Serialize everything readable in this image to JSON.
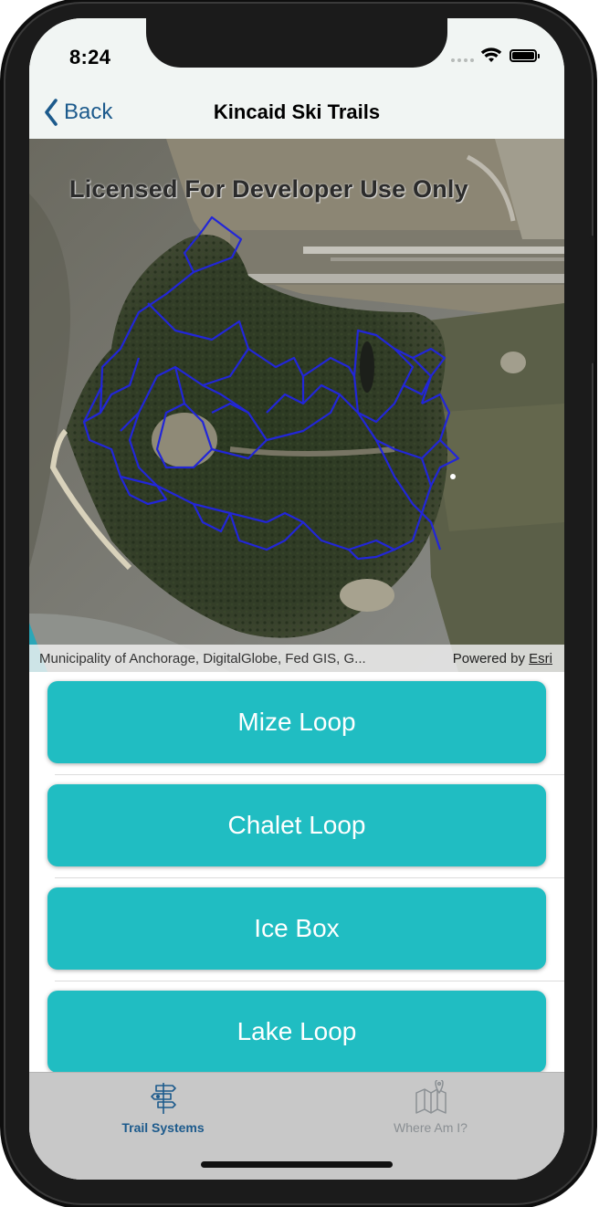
{
  "status_bar": {
    "time": "8:24",
    "signal_icon": "cellular-dots-icon",
    "wifi_icon": "wifi-icon",
    "battery_icon": "battery-icon"
  },
  "nav": {
    "back_label": "Back",
    "back_icon": "chevron-left-icon",
    "title": "Kincaid Ski Trails"
  },
  "map": {
    "watermark": "Licensed For Developer Use Only",
    "attribution": "Municipality of Anchorage, DigitalGlobe, Fed GIS, G...",
    "powered_by_prefix": "Powered by",
    "powered_by_link": "Esri",
    "trail_color": "#2226d8"
  },
  "trails": [
    {
      "label": "Mize Loop"
    },
    {
      "label": "Chalet Loop"
    },
    {
      "label": "Ice Box"
    },
    {
      "label": "Lake Loop"
    }
  ],
  "tabs": [
    {
      "label": "Trail Systems",
      "icon": "signpost-icon",
      "active": true
    },
    {
      "label": "Where Am I?",
      "icon": "map-pin-icon",
      "active": false
    }
  ],
  "colors": {
    "accent": "#20bdc2",
    "nav_tint": "#1c5a8c",
    "tab_bar": "#c8c8c8"
  }
}
